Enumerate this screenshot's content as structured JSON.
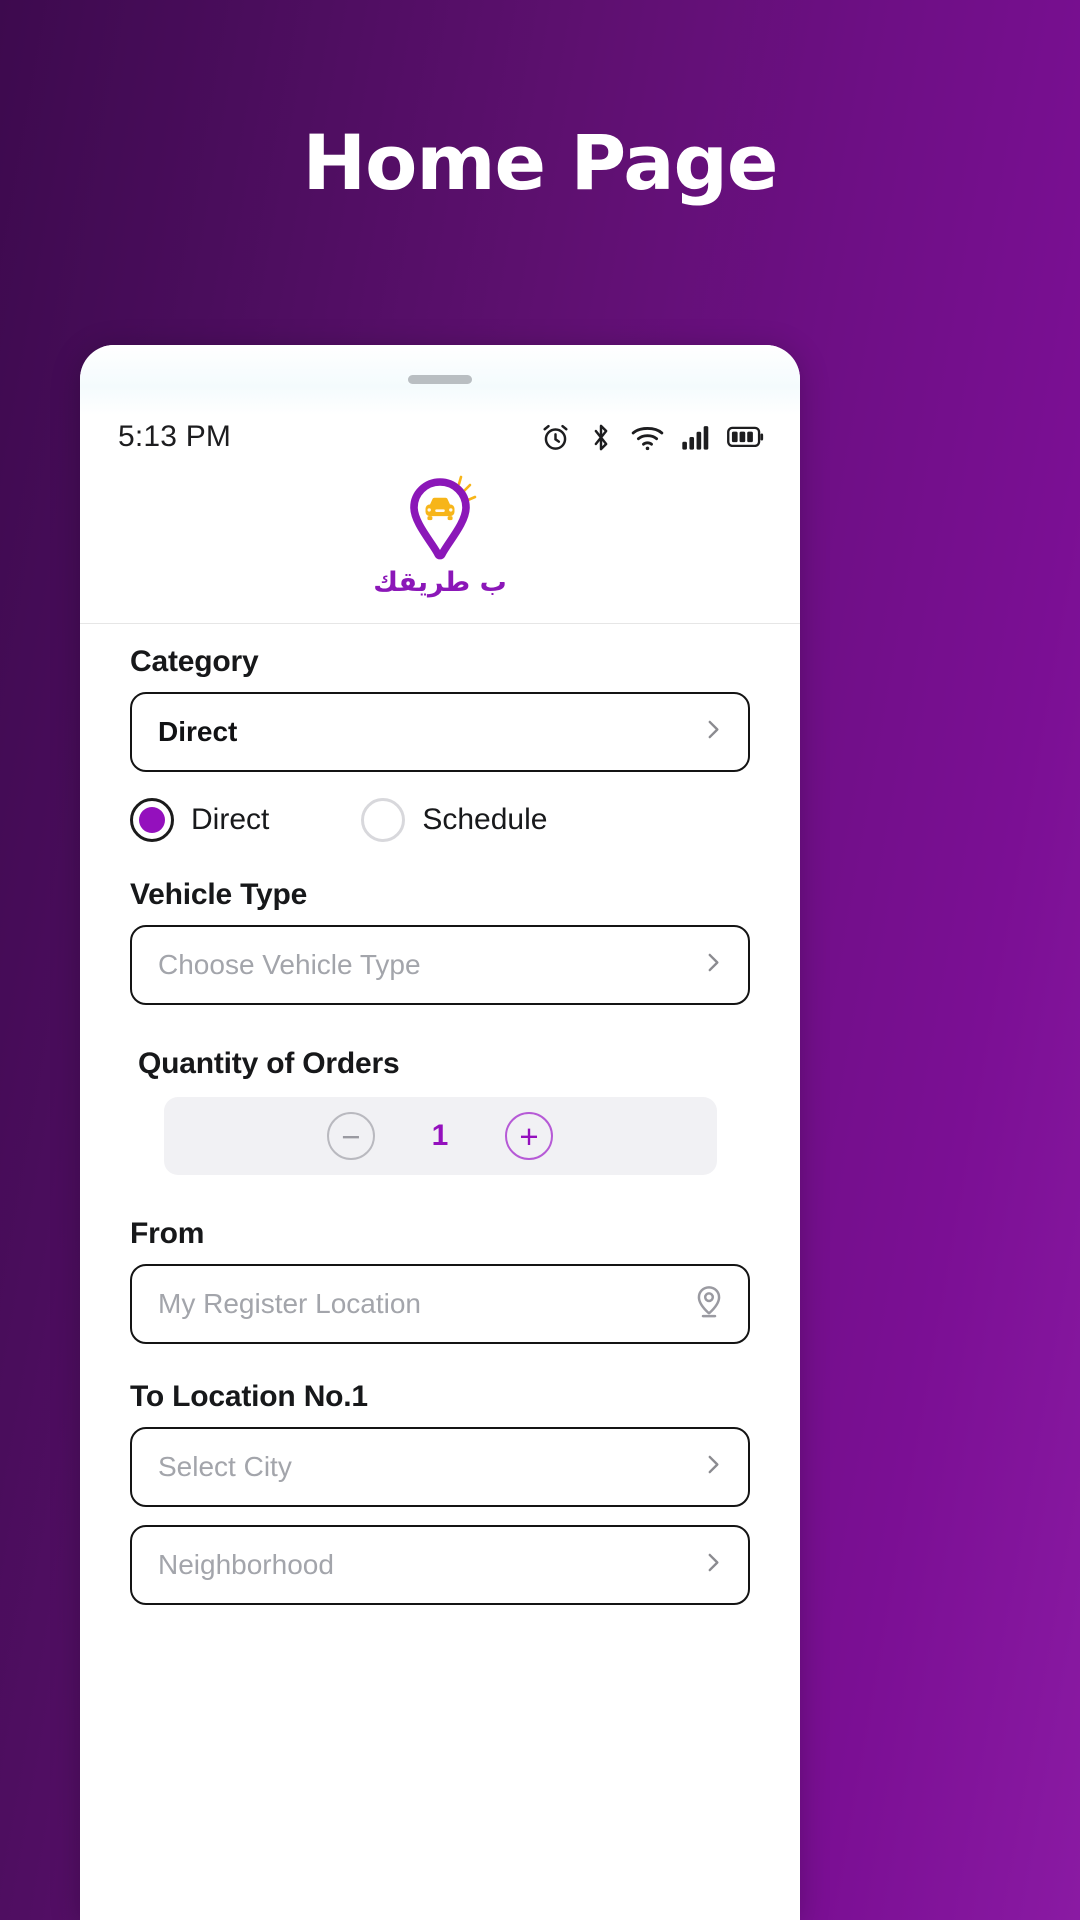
{
  "page": {
    "title": "Home Page",
    "background_gradient_from": "#3d0a4e",
    "background_gradient_to": "#8a1aa3"
  },
  "phone": {
    "status_bar": {
      "time": "5:13 PM",
      "icons": [
        "alarm-icon",
        "bluetooth-icon",
        "wifi-icon",
        "cellular-signal-icon",
        "battery-icon"
      ]
    },
    "logo": {
      "mark": "map-pin-car-icon",
      "wordmark": "ب طريقك",
      "pin_color": "#8b17b8",
      "car_color": "#f7b519"
    },
    "form": {
      "category": {
        "label": "Category",
        "value": "Direct",
        "chevron": "chevron-right-icon"
      },
      "delivery_mode": {
        "options": [
          {
            "label": "Direct",
            "selected": true
          },
          {
            "label": "Schedule",
            "selected": false
          }
        ],
        "accent_color": "#9410bd"
      },
      "vehicle_type": {
        "label": "Vehicle Type",
        "value": "",
        "placeholder": "Choose Vehicle Type",
        "chevron": "chevron-right-icon"
      },
      "quantity": {
        "label": "Quantity of Orders",
        "value": "1",
        "decrement": "minus-circle-icon",
        "increment": "plus-circle-icon"
      },
      "from": {
        "label": "From",
        "value": "",
        "placeholder": "My Register Location",
        "icon": "location-pin-icon"
      },
      "to_location_1": {
        "label": "To Location No.1",
        "city": {
          "value": "",
          "placeholder": "Select City",
          "chevron": "chevron-right-icon"
        },
        "neighborhood": {
          "value": "",
          "placeholder": "Neighborhood",
          "chevron": "chevron-right-icon"
        }
      }
    }
  }
}
